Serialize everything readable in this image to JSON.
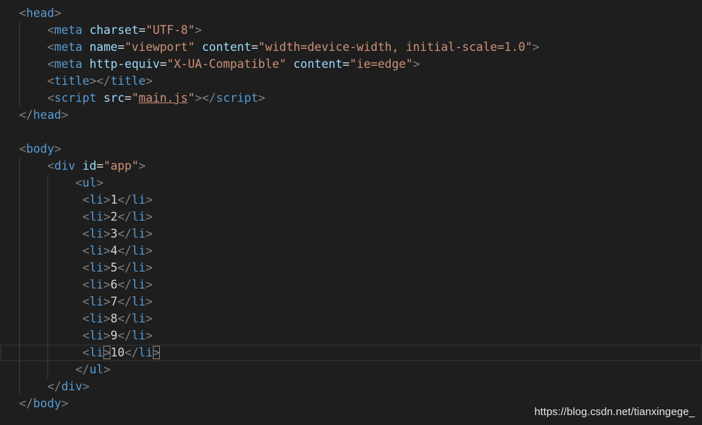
{
  "editor": {
    "lines": [
      {
        "indent": 0,
        "tokens": [
          [
            "punc",
            "<"
          ],
          [
            "tag",
            "head"
          ],
          [
            "punc",
            ">"
          ]
        ]
      },
      {
        "indent": 1,
        "tokens": [
          [
            "punc",
            "<"
          ],
          [
            "tag",
            "meta"
          ],
          [
            "text",
            " "
          ],
          [
            "attr",
            "charset"
          ],
          [
            "eq",
            "="
          ],
          [
            "str",
            "\"UTF-8\""
          ],
          [
            "punc",
            ">"
          ]
        ]
      },
      {
        "indent": 1,
        "tokens": [
          [
            "punc",
            "<"
          ],
          [
            "tag",
            "meta"
          ],
          [
            "text",
            " "
          ],
          [
            "attr",
            "name"
          ],
          [
            "eq",
            "="
          ],
          [
            "str",
            "\"viewport\""
          ],
          [
            "text",
            " "
          ],
          [
            "attr",
            "content"
          ],
          [
            "eq",
            "="
          ],
          [
            "str",
            "\"width=device-width, initial-scale=1.0\""
          ],
          [
            "punc",
            ">"
          ]
        ]
      },
      {
        "indent": 1,
        "tokens": [
          [
            "punc",
            "<"
          ],
          [
            "tag",
            "meta"
          ],
          [
            "text",
            " "
          ],
          [
            "attr",
            "http-equiv"
          ],
          [
            "eq",
            "="
          ],
          [
            "str",
            "\"X-UA-Compatible\""
          ],
          [
            "text",
            " "
          ],
          [
            "attr",
            "content"
          ],
          [
            "eq",
            "="
          ],
          [
            "str",
            "\"ie=edge\""
          ],
          [
            "punc",
            ">"
          ]
        ]
      },
      {
        "indent": 1,
        "tokens": [
          [
            "punc",
            "<"
          ],
          [
            "tag",
            "title"
          ],
          [
            "punc",
            "></"
          ],
          [
            "tag",
            "title"
          ],
          [
            "punc",
            ">"
          ]
        ]
      },
      {
        "indent": 1,
        "tokens": [
          [
            "punc",
            "<"
          ],
          [
            "tag",
            "script"
          ],
          [
            "text",
            " "
          ],
          [
            "attr",
            "src"
          ],
          [
            "eq",
            "="
          ],
          [
            "str",
            "\""
          ],
          [
            "link",
            "main.js"
          ],
          [
            "str",
            "\""
          ],
          [
            "punc",
            "></"
          ],
          [
            "tag",
            "script"
          ],
          [
            "punc",
            ">"
          ]
        ]
      },
      {
        "indent": 0,
        "tokens": [
          [
            "punc",
            "</"
          ],
          [
            "tag",
            "head"
          ],
          [
            "punc",
            ">"
          ]
        ]
      },
      {
        "indent": 0,
        "tokens": []
      },
      {
        "indent": 0,
        "tokens": [
          [
            "punc",
            "<"
          ],
          [
            "tag",
            "body"
          ],
          [
            "punc",
            ">"
          ]
        ]
      },
      {
        "indent": 1,
        "tokens": [
          [
            "punc",
            "<"
          ],
          [
            "tag",
            "div"
          ],
          [
            "text",
            " "
          ],
          [
            "attr",
            "id"
          ],
          [
            "eq",
            "="
          ],
          [
            "str",
            "\"app\""
          ],
          [
            "punc",
            ">"
          ]
        ]
      },
      {
        "indent": 2,
        "tokens": [
          [
            "punc",
            "<"
          ],
          [
            "tag",
            "ul"
          ],
          [
            "punc",
            ">"
          ]
        ]
      },
      {
        "indent": 2,
        "pad": " ",
        "tokens": [
          [
            "punc",
            "<"
          ],
          [
            "tag",
            "li"
          ],
          [
            "punc",
            ">"
          ],
          [
            "text",
            "1"
          ],
          [
            "punc",
            "</"
          ],
          [
            "tag",
            "li"
          ],
          [
            "punc",
            ">"
          ]
        ]
      },
      {
        "indent": 2,
        "pad": " ",
        "tokens": [
          [
            "punc",
            "<"
          ],
          [
            "tag",
            "li"
          ],
          [
            "punc",
            ">"
          ],
          [
            "text",
            "2"
          ],
          [
            "punc",
            "</"
          ],
          [
            "tag",
            "li"
          ],
          [
            "punc",
            ">"
          ]
        ]
      },
      {
        "indent": 2,
        "pad": " ",
        "tokens": [
          [
            "punc",
            "<"
          ],
          [
            "tag",
            "li"
          ],
          [
            "punc",
            ">"
          ],
          [
            "text",
            "3"
          ],
          [
            "punc",
            "</"
          ],
          [
            "tag",
            "li"
          ],
          [
            "punc",
            ">"
          ]
        ]
      },
      {
        "indent": 2,
        "pad": " ",
        "tokens": [
          [
            "punc",
            "<"
          ],
          [
            "tag",
            "li"
          ],
          [
            "punc",
            ">"
          ],
          [
            "text",
            "4"
          ],
          [
            "punc",
            "</"
          ],
          [
            "tag",
            "li"
          ],
          [
            "punc",
            ">"
          ]
        ]
      },
      {
        "indent": 2,
        "pad": " ",
        "tokens": [
          [
            "punc",
            "<"
          ],
          [
            "tag",
            "li"
          ],
          [
            "punc",
            ">"
          ],
          [
            "text",
            "5"
          ],
          [
            "punc",
            "</"
          ],
          [
            "tag",
            "li"
          ],
          [
            "punc",
            ">"
          ]
        ]
      },
      {
        "indent": 2,
        "pad": " ",
        "tokens": [
          [
            "punc",
            "<"
          ],
          [
            "tag",
            "li"
          ],
          [
            "punc",
            ">"
          ],
          [
            "text",
            "6"
          ],
          [
            "punc",
            "</"
          ],
          [
            "tag",
            "li"
          ],
          [
            "punc",
            ">"
          ]
        ]
      },
      {
        "indent": 2,
        "pad": " ",
        "tokens": [
          [
            "punc",
            "<"
          ],
          [
            "tag",
            "li"
          ],
          [
            "punc",
            ">"
          ],
          [
            "text",
            "7"
          ],
          [
            "punc",
            "</"
          ],
          [
            "tag",
            "li"
          ],
          [
            "punc",
            ">"
          ]
        ]
      },
      {
        "indent": 2,
        "pad": " ",
        "tokens": [
          [
            "punc",
            "<"
          ],
          [
            "tag",
            "li"
          ],
          [
            "punc",
            ">"
          ],
          [
            "text",
            "8"
          ],
          [
            "punc",
            "</"
          ],
          [
            "tag",
            "li"
          ],
          [
            "punc",
            ">"
          ]
        ]
      },
      {
        "indent": 2,
        "pad": " ",
        "tokens": [
          [
            "punc",
            "<"
          ],
          [
            "tag",
            "li"
          ],
          [
            "punc",
            ">"
          ],
          [
            "text",
            "9"
          ],
          [
            "punc",
            "</"
          ],
          [
            "tag",
            "li"
          ],
          [
            "punc",
            ">"
          ]
        ]
      },
      {
        "indent": 2,
        "pad": " ",
        "current": true,
        "tokens": [
          [
            "punc",
            "<"
          ],
          [
            "tag",
            "li"
          ],
          [
            "punc",
            ">"
          ],
          [
            "text",
            "10"
          ],
          [
            "punc",
            "</"
          ],
          [
            "tag",
            "li"
          ],
          [
            "punc",
            ">"
          ]
        ]
      },
      {
        "indent": 2,
        "tokens": [
          [
            "punc",
            "</"
          ],
          [
            "tag",
            "ul"
          ],
          [
            "punc",
            ">"
          ]
        ]
      },
      {
        "indent": 1,
        "tokens": [
          [
            "punc",
            "</"
          ],
          [
            "tag",
            "div"
          ],
          [
            "punc",
            ">"
          ]
        ]
      },
      {
        "indent": 0,
        "tokens": [
          [
            "punc",
            "</"
          ],
          [
            "tag",
            "body"
          ],
          [
            "punc",
            ">"
          ]
        ]
      }
    ]
  },
  "watermark": "https://blog.csdn.net/tianxingege_",
  "colors": {
    "background": "#1e1e1e",
    "punctuation": "#808080",
    "tag": "#569cd6",
    "attribute": "#9cdcfe",
    "string": "#ce9178",
    "text": "#d4d4d4"
  }
}
